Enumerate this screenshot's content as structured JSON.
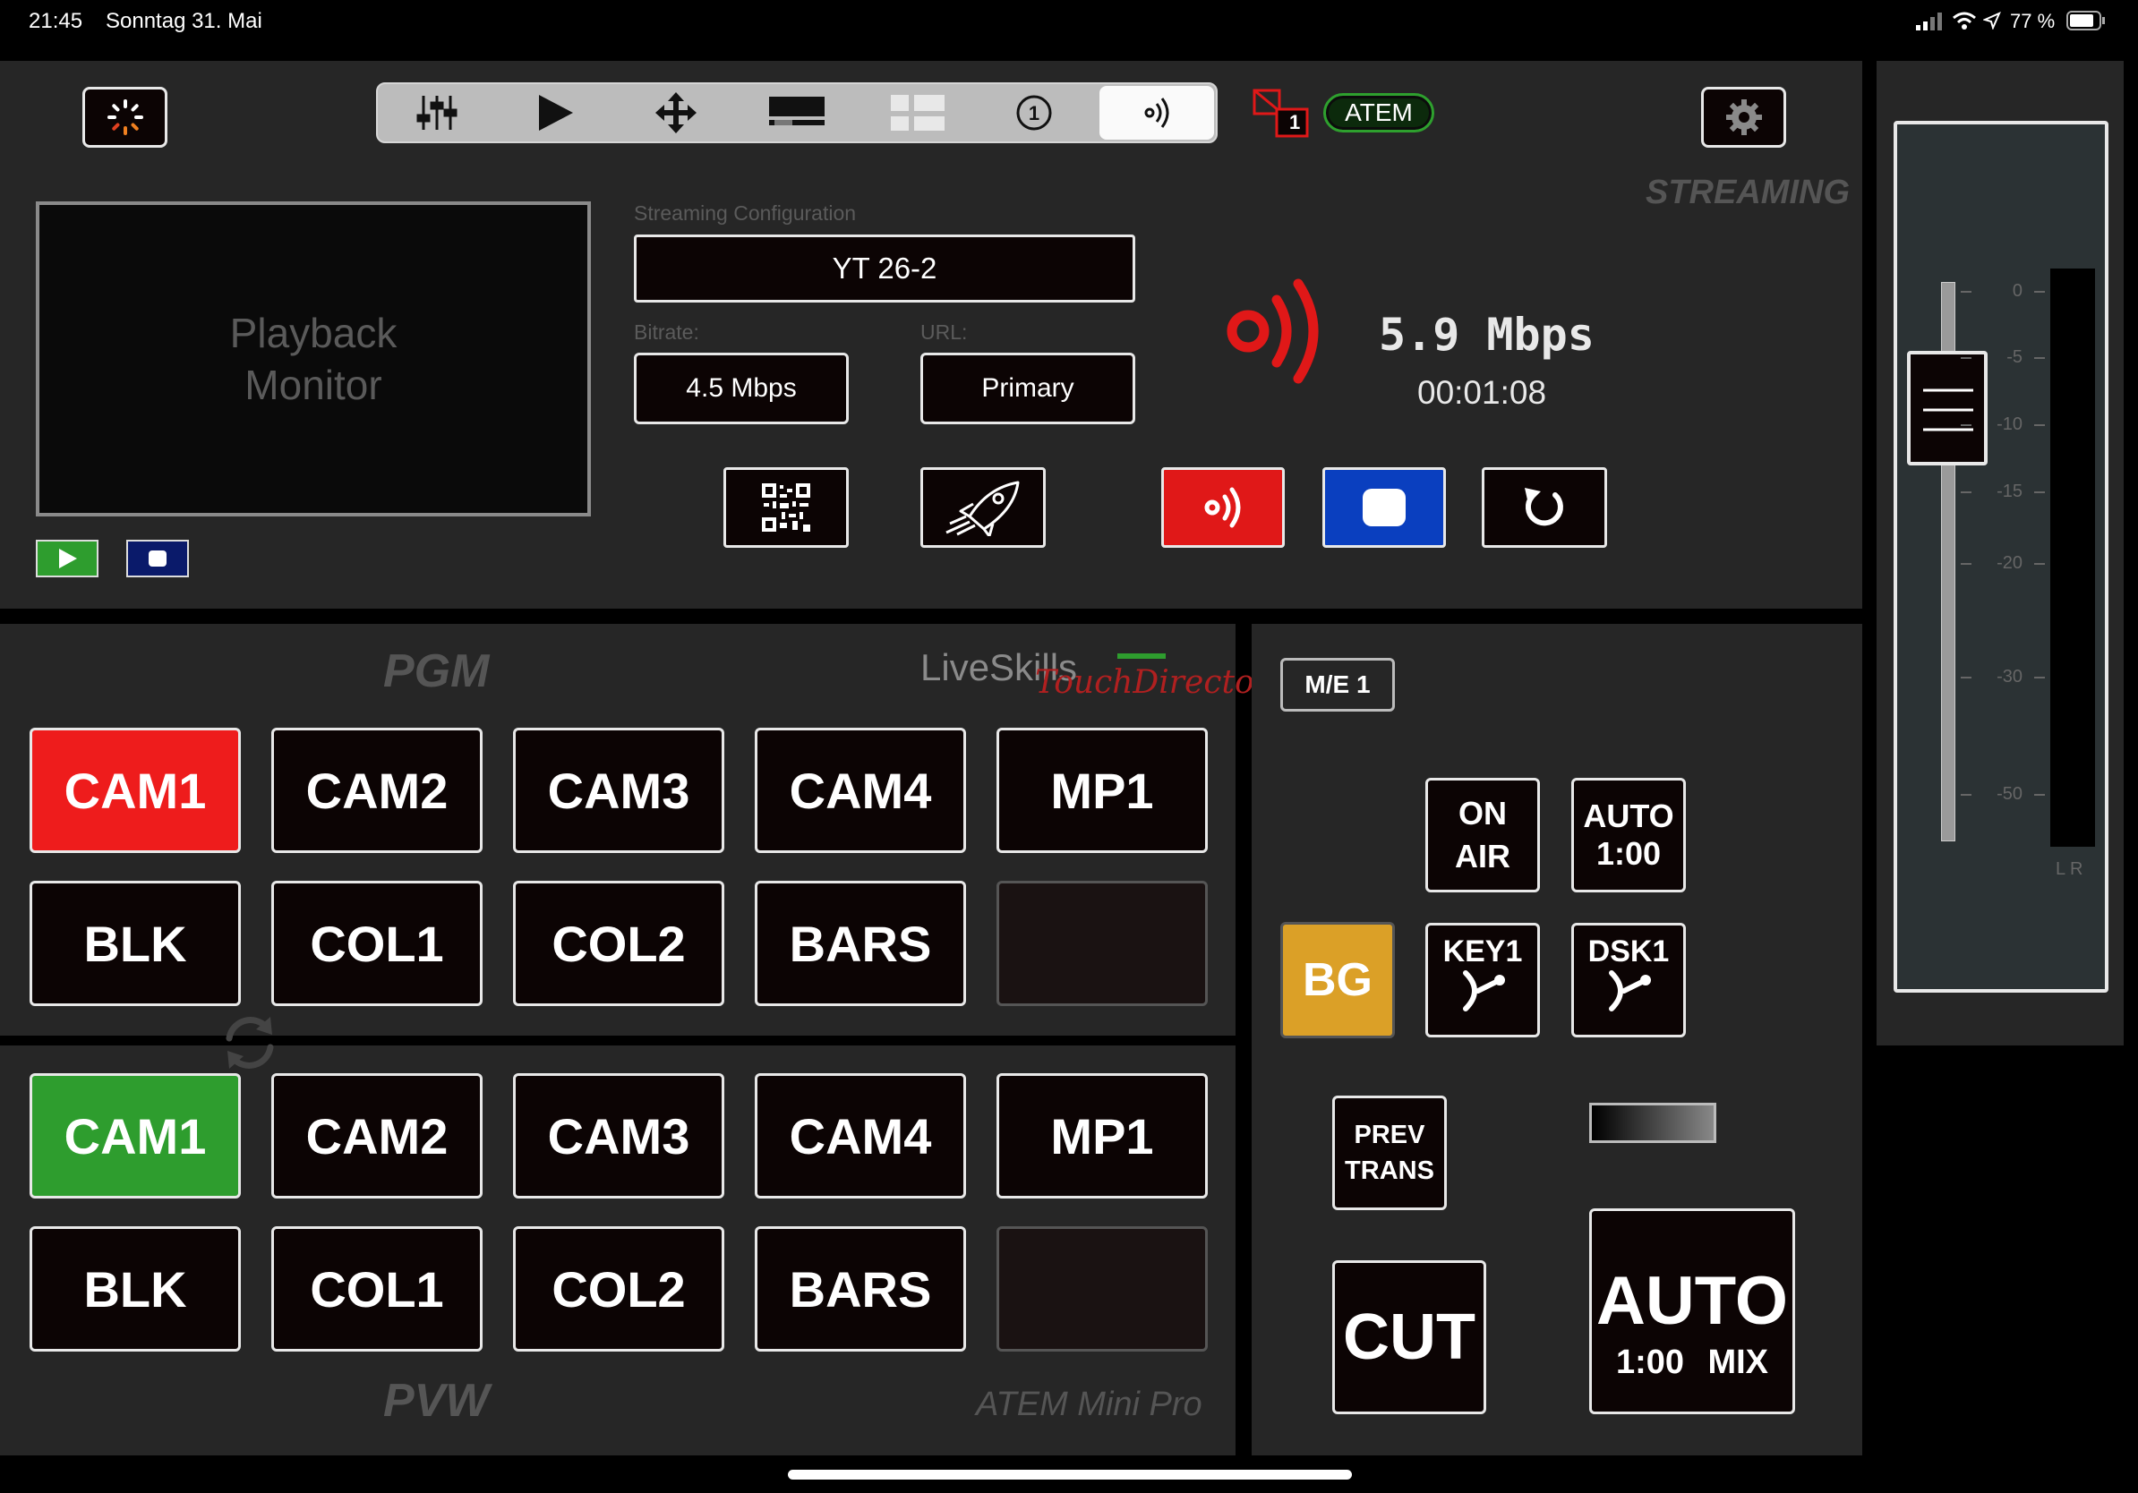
{
  "status_bar": {
    "time": "21:45",
    "date": "Sonntag 31. Mai",
    "battery": "77 %",
    "icons": [
      "signal-icon",
      "wifi-icon",
      "location-icon",
      "battery-icon"
    ]
  },
  "toolbar": {
    "tabs": [
      "mixer-sliders-icon",
      "play-icon",
      "move-arrows-icon",
      "monitor-icon",
      "grid-icon",
      "number-one-icon",
      "broadcast-icon"
    ],
    "active_tab": 6,
    "badge_number": "1",
    "atem_label": "ATEM"
  },
  "streaming": {
    "section_title": "STREAMING",
    "playback_monitor": [
      "Playback",
      "Monitor"
    ],
    "config_label": "Streaming Configuration",
    "config_value": "YT 26-2",
    "bitrate_label": "Bitrate:",
    "bitrate_value": "4.5 Mbps",
    "url_label": "URL:",
    "url_value": "Primary",
    "rate": "5.9 Mbps",
    "duration": "00:01:08"
  },
  "pgm": {
    "title": "PGM",
    "brand": "LiveSkills",
    "brand_sub": "TouchDirector",
    "row1": [
      "CAM1",
      "CAM2",
      "CAM3",
      "CAM4",
      "MP1"
    ],
    "row2": [
      "BLK",
      "COL1",
      "COL2",
      "BARS",
      ""
    ]
  },
  "pvw": {
    "title": "PVW",
    "model": "ATEM Mini Pro",
    "row1": [
      "CAM1",
      "CAM2",
      "CAM3",
      "CAM4",
      "MP1"
    ],
    "row2": [
      "BLK",
      "COL1",
      "COL2",
      "BARS",
      ""
    ]
  },
  "transition": {
    "me_label": "M/E 1",
    "on_air": [
      "ON",
      "AIR"
    ],
    "auto_small": [
      "AUTO",
      "1:00"
    ],
    "bg": "BG",
    "key1": "KEY1",
    "dsk1": "DSK1",
    "prev_trans": [
      "PREV",
      "TRANS"
    ],
    "cut": "CUT",
    "auto": "AUTO",
    "auto_rate": "1:00",
    "auto_mix": "MIX"
  },
  "audio": {
    "scale": [
      "0",
      "-5",
      "-10",
      "-15",
      "-20",
      "-30",
      "-50"
    ],
    "channels": "L R"
  },
  "colors": {
    "program_red": "#ee1c1c",
    "preview_green": "#2e9d2e",
    "bg_amber": "#dba027",
    "stop_blue": "#0a3fbf",
    "tally_red": "#e01818"
  }
}
